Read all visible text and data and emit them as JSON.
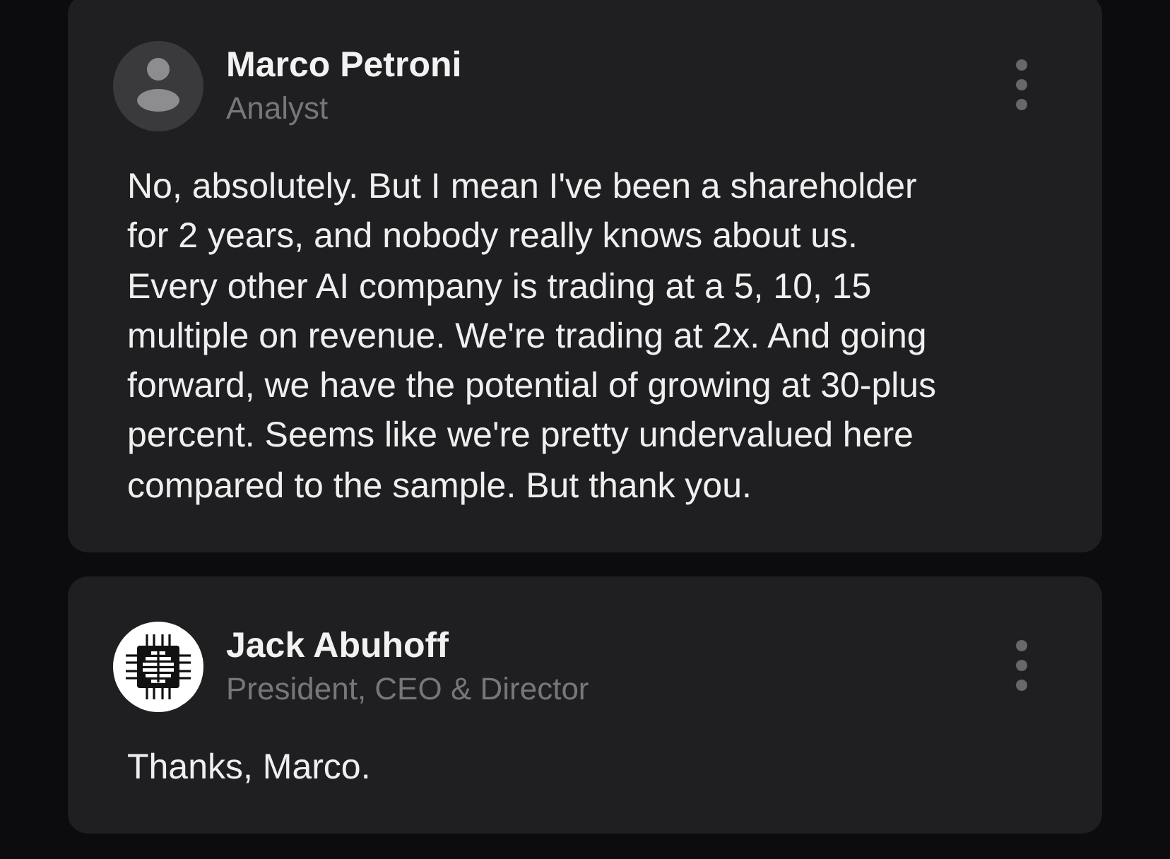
{
  "comments": [
    {
      "author": "Marco Petroni",
      "role": "Analyst",
      "avatar": {
        "kind": "silhouette"
      },
      "text": "No, absolutely. But I mean I've been a shareholder\nfor 2 years, and nobody really knows about us.\nEvery other AI company is trading at a 5, 10, 15\nmultiple on revenue. We're trading at 2x. And going\nforward, we have the potential of growing at 30-plus\npercent. Seems like we're pretty undervalued here\ncompared to the sample. But thank you."
    },
    {
      "author": "Jack Abuhoff",
      "role": "President, CEO & Director",
      "avatar": {
        "kind": "chip"
      },
      "text": "Thanks, Marco."
    }
  ]
}
